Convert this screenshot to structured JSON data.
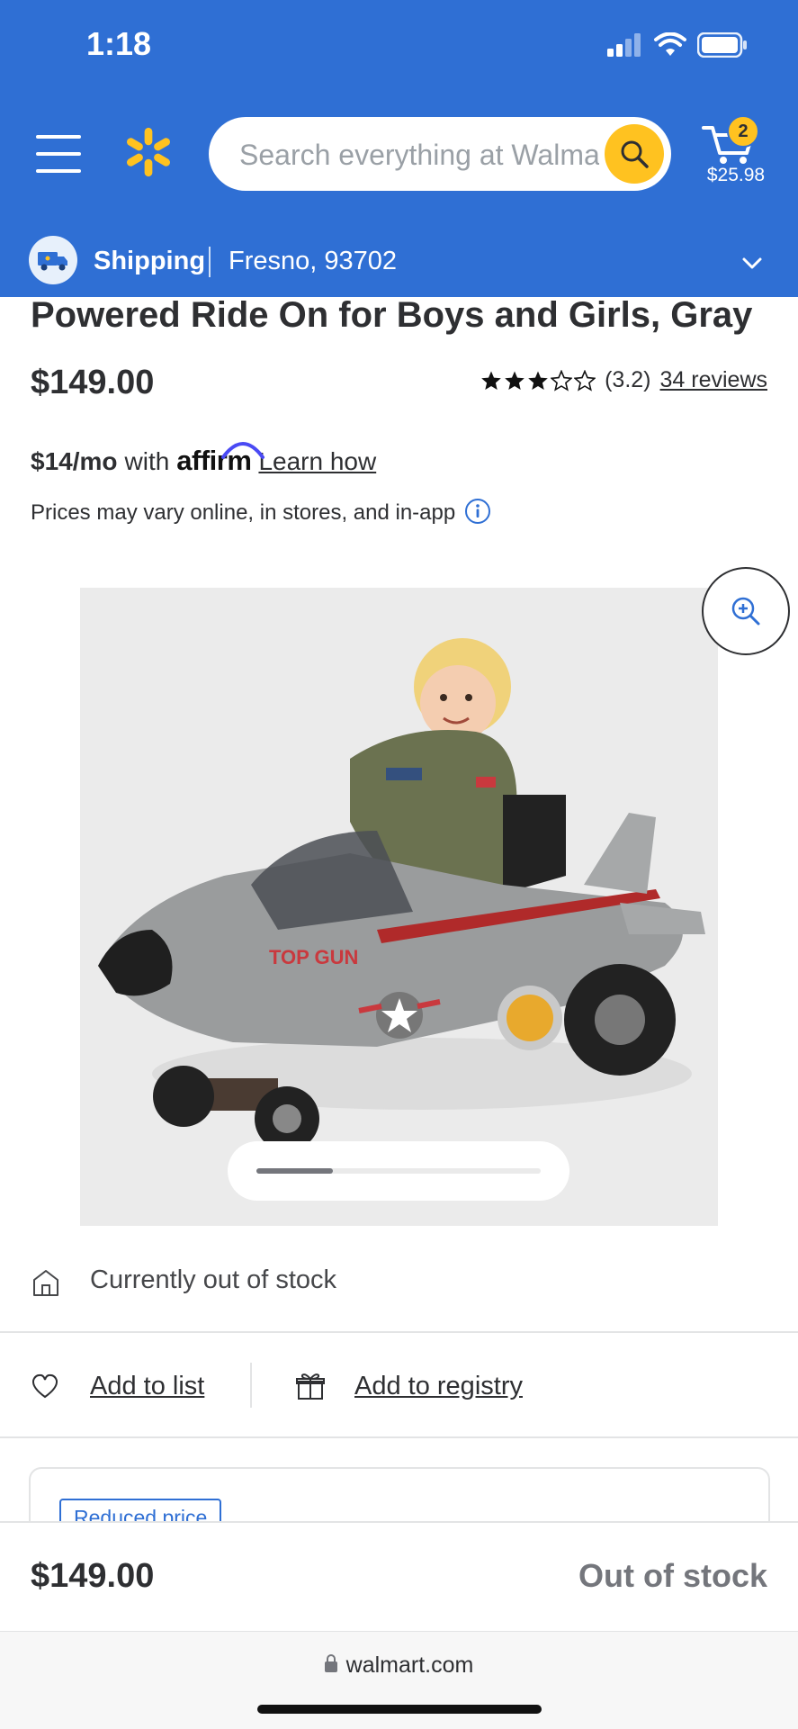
{
  "status_bar": {
    "time": "1:18"
  },
  "header": {
    "search_placeholder": "Search everything at Walmart online and in store",
    "cart": {
      "count": "2",
      "total": "$25.98"
    },
    "shipping": {
      "label": "Shipping",
      "location": "Fresno, 93702"
    }
  },
  "product": {
    "title": "Powered Ride On for Boys and Girls, Gray",
    "price": "$149.00",
    "rating": {
      "value_text": "(3.2)",
      "stars": 3.2,
      "reviews_link": "34 reviews"
    },
    "affirm": {
      "amount": "$14/mo",
      "with": "with",
      "brand": "affirm",
      "learn": "Learn how"
    },
    "prices_note": "Prices may vary online, in stores, and in-app",
    "image_alt": "Top Gun jet ride-on toy with child",
    "image_text": "TOP GUN",
    "carousel_progress": 0.27
  },
  "availability": {
    "stock": "Currently out of stock"
  },
  "actions": {
    "add_to_list": "Add to list",
    "add_to_registry": "Add to registry"
  },
  "offer_card": {
    "badge": "Reduced price"
  },
  "sticky_bar": {
    "price": "$149.00",
    "status": "Out of stock"
  },
  "browser": {
    "url": "walmart.com"
  },
  "colors": {
    "brand_blue": "#2f6fd4",
    "spark_yellow": "#ffc220",
    "text": "#2e2f32",
    "muted": "#74767c"
  }
}
